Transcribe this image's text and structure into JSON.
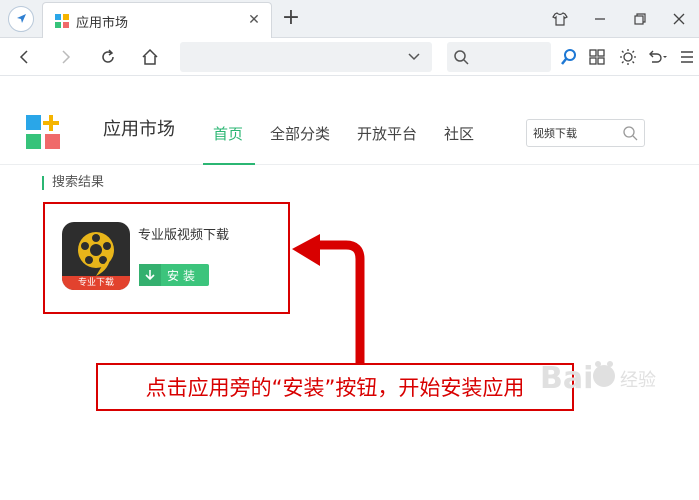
{
  "browser": {
    "tab_title": "应用市场",
    "tab_close": "✕",
    "new_tab": "+",
    "address_value": "",
    "search_value": ""
  },
  "market": {
    "title": "应用市场",
    "nav": [
      "首页",
      "全部分类",
      "开放平台",
      "社区"
    ],
    "active_nav": "首页",
    "search_value": "视频下载",
    "results_label": "搜索结果"
  },
  "result": {
    "app_name": "专业版视频下载",
    "icon_caption": "专业下载",
    "install_label": "安装"
  },
  "annotation": {
    "callout_text": "点击应用旁的“安装”按钮，开始安装应用"
  },
  "colors": {
    "accent": "#2bb673",
    "highlight_red": "#d80000",
    "install_green": "#3cc47c"
  }
}
